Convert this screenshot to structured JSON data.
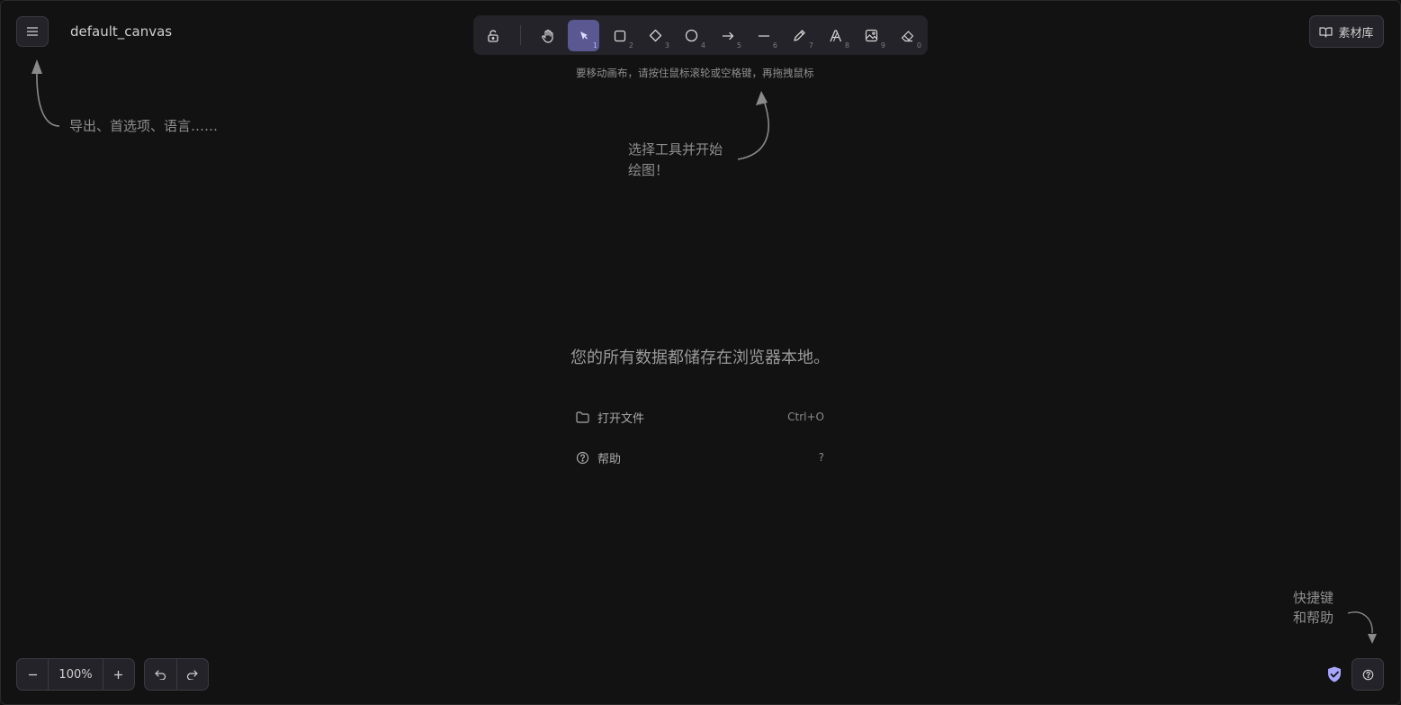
{
  "header": {
    "menu_icon": "hamburger-icon",
    "canvas_name": "default_canvas"
  },
  "toolbar": {
    "tools": [
      {
        "name": "lock",
        "icon": "unlock-icon",
        "key": ""
      },
      {
        "name": "hand",
        "icon": "hand-icon",
        "key": ""
      },
      {
        "name": "selection",
        "icon": "pointer-icon",
        "key": "1",
        "active": true
      },
      {
        "name": "rectangle",
        "icon": "square-icon",
        "key": "2"
      },
      {
        "name": "diamond",
        "icon": "diamond-icon",
        "key": "3"
      },
      {
        "name": "ellipse",
        "icon": "circle-icon",
        "key": "4"
      },
      {
        "name": "arrow",
        "icon": "arrow-right-icon",
        "key": "5"
      },
      {
        "name": "line",
        "icon": "line-icon",
        "key": "6"
      },
      {
        "name": "draw",
        "icon": "pencil-icon",
        "key": "7"
      },
      {
        "name": "text",
        "icon": "text-icon",
        "key": "8"
      },
      {
        "name": "image",
        "icon": "image-icon",
        "key": "9"
      },
      {
        "name": "eraser",
        "icon": "eraser-icon",
        "key": "0"
      }
    ],
    "active_color": "#5b5791"
  },
  "hints": {
    "canvas_move": "要移动画布，请按住鼠标滚轮或空格键，再拖拽鼠标",
    "menu": "导出、首选项、语言……",
    "tool_line1": "选择工具并开始",
    "tool_line2": "绘图！",
    "help_line1": "快捷键",
    "help_line2": "和帮助"
  },
  "welcome": {
    "title": "您的所有数据都储存在浏览器本地。",
    "items": [
      {
        "label": "打开文件",
        "shortcut": "Ctrl+O",
        "icon": "folder-icon"
      },
      {
        "label": "帮助",
        "shortcut": "?",
        "icon": "question-circle-icon"
      }
    ]
  },
  "library": {
    "label": "素材库",
    "icon": "book-icon"
  },
  "footer": {
    "zoom_level": "100%",
    "zoom_out_icon": "minus-icon",
    "zoom_in_icon": "plus-icon",
    "undo_icon": "undo-icon",
    "redo_icon": "redo-icon",
    "shield_icon": "shield-check-icon",
    "shield_color": "#a8a5ff",
    "help_icon": "question-circle-icon"
  }
}
